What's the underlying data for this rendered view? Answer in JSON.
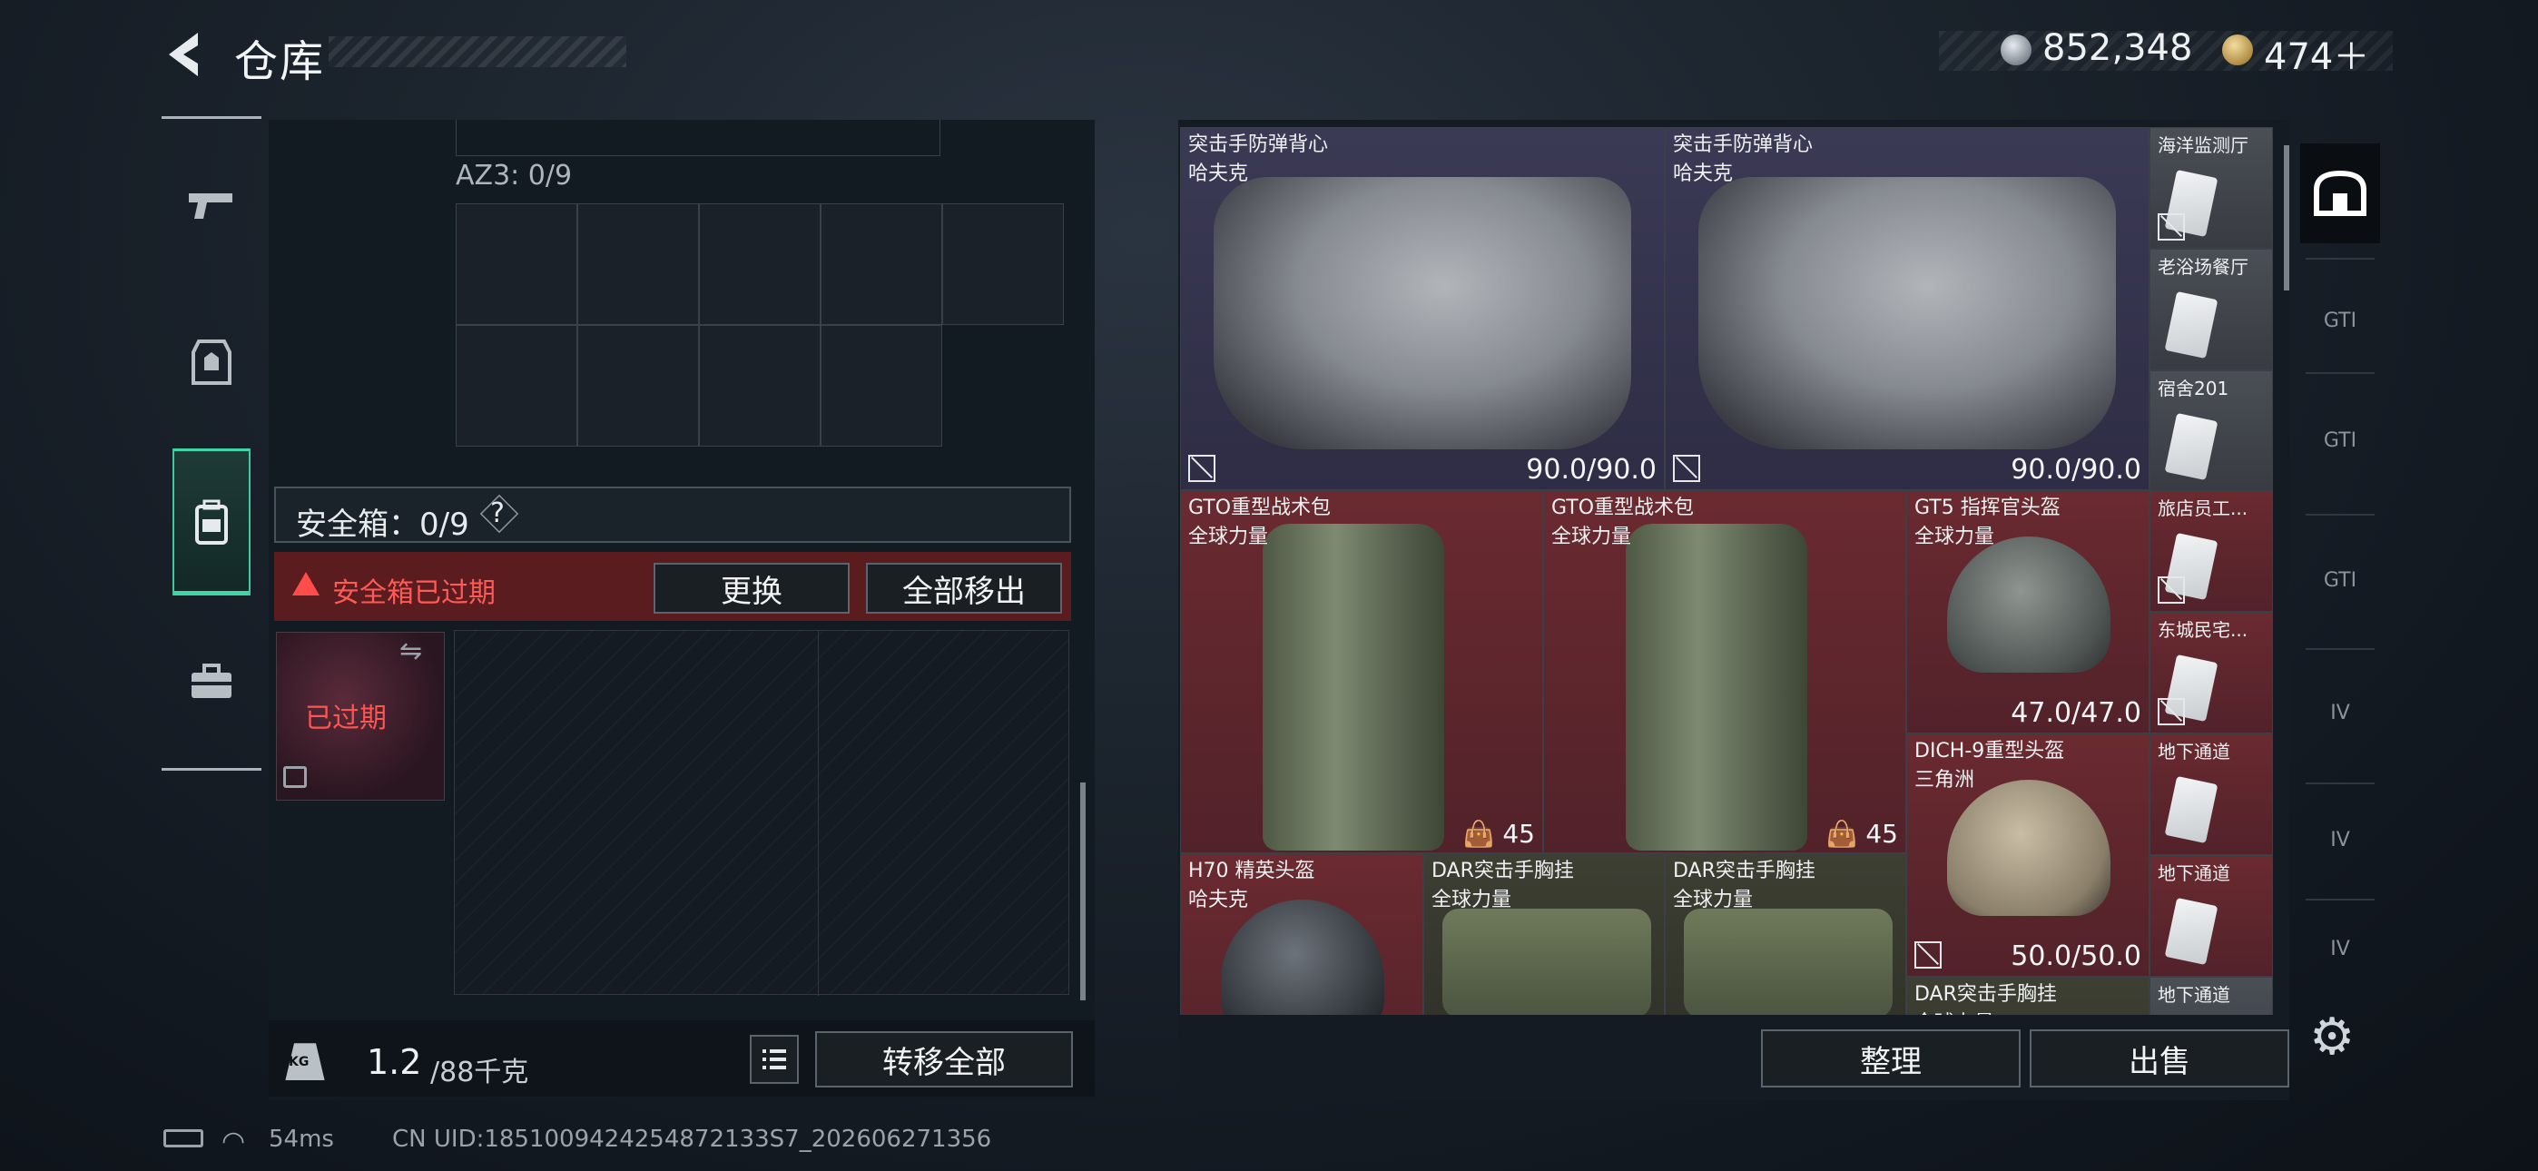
{
  "header": {
    "title": "仓库",
    "currency": [
      {
        "icon": "silver-coin-icon",
        "value": "852,348"
      },
      {
        "icon": "gold-coin-icon",
        "value": "474＋"
      }
    ]
  },
  "categories": [
    {
      "name": "weapon",
      "icon": "pistol-icon"
    },
    {
      "name": "armor",
      "icon": "armor-icon"
    },
    {
      "name": "backpack",
      "icon": "backpack-icon",
      "active": true
    },
    {
      "name": "supplies",
      "icon": "toolbox-icon"
    }
  ],
  "left": {
    "az3_label": "AZ3: 0/9",
    "safe_label": "安全箱：0/9",
    "help": "?",
    "expired_msg": "安全箱已过期",
    "replace_btn": "更换",
    "move_all_btn": "全部移出",
    "slot_expired": "已过期",
    "weight_value": "1.2",
    "weight_unit": "/88千克",
    "kg_label": "KG",
    "transfer_all_btn": "转移全部"
  },
  "status": {
    "ping": "54ms",
    "uid": "CN UID:1851009424254872133S7_202606271356"
  },
  "stash": {
    "items": [
      {
        "name": "突击手防弹背心",
        "sub": "哈夫克",
        "dur": "90.0/90.0"
      },
      {
        "name": "突击手防弹背心",
        "sub": "哈夫克",
        "dur": "90.0/90.0"
      },
      {
        "name": "GTO重型战术包",
        "sub": "全球力量",
        "count": "45"
      },
      {
        "name": "GTO重型战术包",
        "sub": "全球力量",
        "count": "45"
      },
      {
        "name": "GT5 指挥官头盔",
        "sub": "全球力量",
        "dur": "47.0/47.0"
      },
      {
        "name": "DICH-9重型头盔",
        "sub": "三角洲",
        "dur": "50.0/50.0"
      },
      {
        "name": "H70 精英头盔",
        "sub": "哈夫克"
      },
      {
        "name": "DAR突击手胸挂",
        "sub": "全球力量"
      },
      {
        "name": "DAR突击手胸挂",
        "sub": "全球力量"
      },
      {
        "name": "DAR突击手胸挂",
        "sub": "全球力量"
      }
    ],
    "keys": [
      "海洋监测厅",
      "老浴场餐厅",
      "宿舍201",
      "旅店员工...",
      "东城民宅...",
      "地下通道",
      "地下通道",
      "地下通道"
    ],
    "sort_btn": "整理",
    "sell_btn": "出售"
  },
  "filters": [
    "GTI",
    "GTI",
    "GTI",
    "IV",
    "IV",
    "IV"
  ]
}
